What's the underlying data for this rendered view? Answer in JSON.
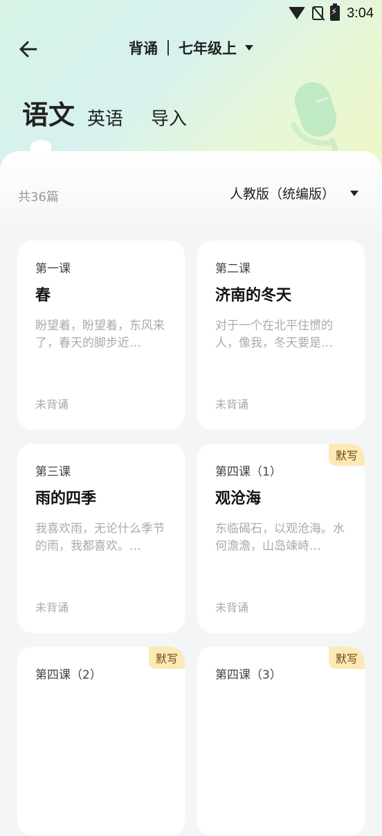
{
  "status_bar": {
    "time": "3:04"
  },
  "header": {
    "title": "背诵",
    "grade": "七年级上"
  },
  "tabs": [
    {
      "label": "语文",
      "active": true
    },
    {
      "label": "英语",
      "active": false
    },
    {
      "label": "导入",
      "active": false
    }
  ],
  "list": {
    "count": "共36篇",
    "edition": "人教版（统编版）"
  },
  "cards": [
    {
      "lesson": "第一课",
      "title": "春",
      "excerpt": "盼望着，盼望着，东风来了，春天的脚步近…",
      "status": "未背诵",
      "badge": ""
    },
    {
      "lesson": "第二课",
      "title": "济南的冬天",
      "excerpt": "对于一个在北平住惯的人，像我，冬天要是…",
      "status": "未背诵",
      "badge": ""
    },
    {
      "lesson": "第三课",
      "title": "雨的四季",
      "excerpt": "我喜欢雨，无论什么季节的雨，我都喜欢。…",
      "status": "未背诵",
      "badge": ""
    },
    {
      "lesson": "第四课（1）",
      "title": "观沧海",
      "excerpt": "东临碣石，以观沧海。水何澹澹，山岛竦峙…",
      "status": "未背诵",
      "badge": "默写"
    },
    {
      "lesson": "第四课（2）",
      "title": "",
      "excerpt": "",
      "status": "",
      "badge": "默写"
    },
    {
      "lesson": "第四课（3）",
      "title": "",
      "excerpt": "",
      "status": "",
      "badge": "默写"
    }
  ],
  "colors": {
    "badge_bg": "#fde9b5",
    "hero_start": "#d6f3e5",
    "hero_end": "#eef7c6"
  }
}
